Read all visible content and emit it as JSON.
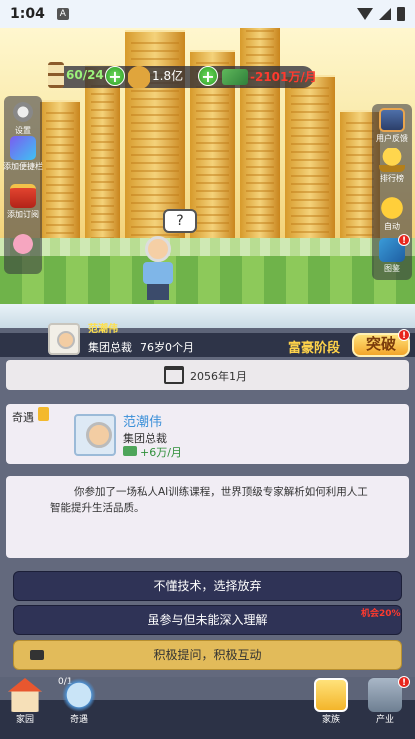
{
  "status": {
    "time": "1:04",
    "notif": "A"
  },
  "resources": {
    "energy": "60/24",
    "money": "1.8亿",
    "income": "-2101万/月"
  },
  "side_left": {
    "settings": "设置",
    "add_shortcut": "添加便捷栏",
    "subscribe": "添加订阅"
  },
  "side_right": {
    "feedback": "用户反馈",
    "ranking": "排行榜",
    "auto": "自动",
    "atlas": "图鉴"
  },
  "bubble": "?",
  "player": {
    "name": "范潮伟",
    "title": "集团总裁",
    "age": "76岁0个月",
    "stage": "富豪阶段",
    "breakthrough": "突破"
  },
  "event": {
    "date": "2056年1月",
    "tag": "奇遇",
    "person_name": "范潮伟",
    "person_title": "集团总裁",
    "income": "+6万/月",
    "text": "你参加了一场私人AI训练课程，世界顶级专家解析如何利用人工智能提升生活品质。"
  },
  "choices": [
    {
      "label": "不懂技术，选择放弃"
    },
    {
      "label": "虽参与但未能深入理解",
      "badge": "机会20%"
    },
    {
      "label": "积极提问，积极互动"
    }
  ],
  "nav": {
    "home": "家园",
    "wonder": "奇遇",
    "wonder_count": "0/1",
    "family": "家族",
    "industry": "产业"
  },
  "red_dot": "!"
}
